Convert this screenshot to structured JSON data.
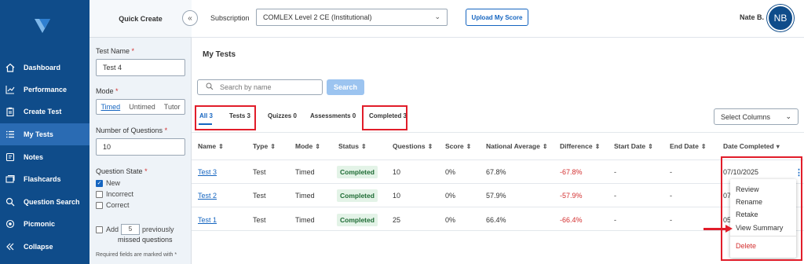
{
  "sidebar": {
    "items": [
      {
        "label": "Dashboard",
        "icon": "home-icon"
      },
      {
        "label": "Performance",
        "icon": "chart-line-icon"
      },
      {
        "label": "Create Test",
        "icon": "clipboard-icon"
      },
      {
        "label": "My Tests",
        "icon": "list-icon",
        "active": true
      },
      {
        "label": "Notes",
        "icon": "notes-icon"
      },
      {
        "label": "Flashcards",
        "icon": "flashcards-icon"
      },
      {
        "label": "Question Search",
        "icon": "search-icon"
      },
      {
        "label": "Picmonic",
        "icon": "picmonic-icon"
      },
      {
        "label": "Collapse",
        "icon": "double-chevron-left-icon"
      }
    ]
  },
  "quick_create": {
    "title": "Quick Create",
    "test_name_label": "Test Name",
    "test_name_value": "Test 4",
    "mode_label": "Mode",
    "modes": [
      "Timed",
      "Untimed",
      "Tutor"
    ],
    "selected_mode": "Timed",
    "num_questions_label": "Number of Questions",
    "num_questions_value": "10",
    "question_state_label": "Question State",
    "states": [
      {
        "label": "New",
        "checked": true
      },
      {
        "label": "Incorrect",
        "checked": false
      },
      {
        "label": "Correct",
        "checked": false
      }
    ],
    "add_prefix": "Add",
    "add_count": "5",
    "add_suffix_1": "previously",
    "add_suffix_2": "missed questions",
    "required_note": "Required fields are marked with *",
    "required_marker": "*"
  },
  "topbar": {
    "subscription_label": "Subscription",
    "subscription_value": "COMLEX Level 2 CE (Institutional)",
    "upload_button": "Upload My Score",
    "user_name": "Nate B.",
    "avatar_initials": "NB"
  },
  "main": {
    "title": "My Tests",
    "search_placeholder": "Search by name",
    "search_button": "Search",
    "tabs": [
      {
        "label": "All 3",
        "active": true
      },
      {
        "label": "Tests 3"
      },
      {
        "label": "Quizzes 0"
      },
      {
        "label": "Assessments 0"
      },
      {
        "label": "Completed 3"
      }
    ],
    "select_columns": "Select Columns",
    "columns": [
      "Name",
      "Type",
      "Mode",
      "Status",
      "Questions",
      "Score",
      "National Average",
      "Difference",
      "Start Date",
      "End Date",
      "Date Completed"
    ],
    "rows": [
      {
        "name": "Test 3",
        "type": "Test",
        "mode": "Timed",
        "status": "Completed",
        "questions": "10",
        "score": "0%",
        "national_average": "67.8%",
        "difference": "-67.8%",
        "start_date": "-",
        "end_date": "-",
        "date_completed": "07/10/2025"
      },
      {
        "name": "Test 2",
        "type": "Test",
        "mode": "Timed",
        "status": "Completed",
        "questions": "10",
        "score": "0%",
        "national_average": "57.9%",
        "difference": "-57.9%",
        "start_date": "-",
        "end_date": "-",
        "date_completed": "07"
      },
      {
        "name": "Test 1",
        "type": "Test",
        "mode": "Timed",
        "status": "Completed",
        "questions": "25",
        "score": "0%",
        "national_average": "66.4%",
        "difference": "-66.4%",
        "start_date": "-",
        "end_date": "-",
        "date_completed": "05"
      }
    ],
    "context_menu": [
      "Review",
      "Rename",
      "Retake",
      "View Summary",
      "Delete"
    ]
  },
  "colors": {
    "sidebar_bg": "#0f4c8a",
    "accent": "#1565c0",
    "highlight": "#e11d2a",
    "negative": "#d32f2f",
    "success_bg": "#e3f3e7"
  }
}
